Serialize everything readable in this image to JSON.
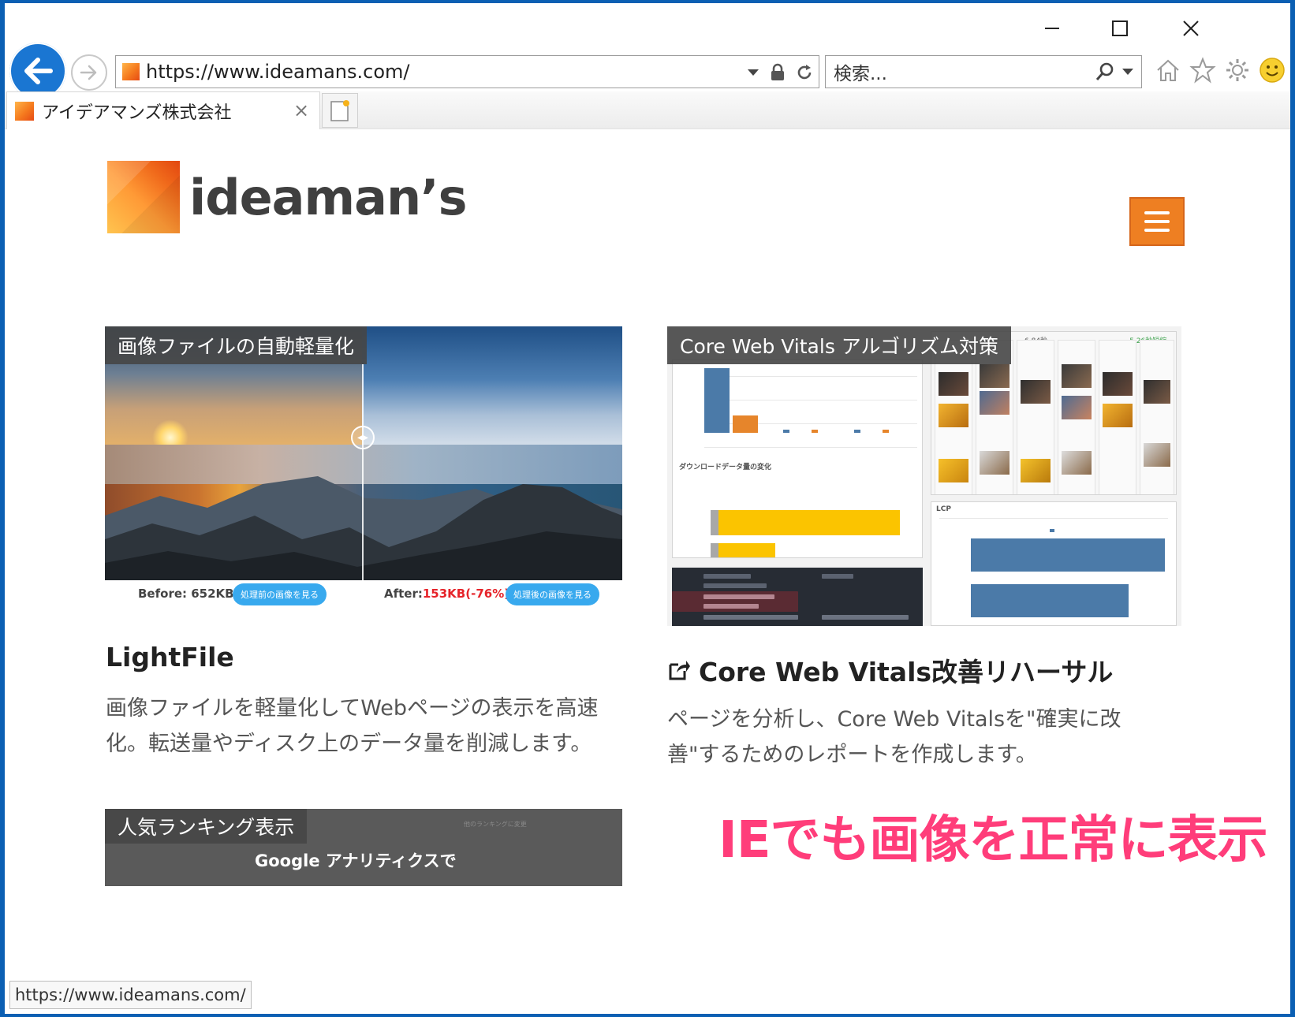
{
  "window": {
    "minimize_label": "minimize",
    "maximize_label": "maximize",
    "close_label": "close"
  },
  "browser": {
    "address": "https://www.ideamans.com/",
    "search_placeholder": "検索...",
    "tab_title": "アイデアマンズ株式会社",
    "status_url": "https://www.ideamans.com/"
  },
  "site": {
    "logo_text": "ideaman’s",
    "accent": "#ee7f22"
  },
  "cards": [
    {
      "label": "画像ファイルの自動軽量化",
      "title": "LightFile",
      "desc": "画像ファイルを軽量化してWebページの表示を高速化。転送量やディスク上のデータ量を削減します。",
      "image": {
        "before_text": "Before: 652KB",
        "after_prefix": "After:",
        "after_value": "153KB(-76%)",
        "before_button": "処理前の画像を見る",
        "after_button": "処理後の画像を見る"
      }
    },
    {
      "label": "Core Web Vitals アルゴリズム対策",
      "title": "Core Web Vitals改善リハーサル",
      "desc": "ページを分析し、Core Web Vitalsを\"確実に改善\"するためのレポートを作成します。",
      "image": {
        "chart_caption": "ダウンロードデータ量の変化",
        "lcp_title": "LCP",
        "badge_left": "6.84秒",
        "badge_right": "-5.26秒短縮"
      }
    }
  ],
  "bottom_card": {
    "label": "人気ランキング表示",
    "subtitle": "Google アナリティクスで",
    "faint": "他のランキングに変更"
  },
  "annotation": {
    "text": "IEでも画像を正常に表示",
    "color": "#ff3d7a"
  },
  "icons": {
    "back": "back-arrow-icon",
    "forward": "forward-arrow-icon",
    "lock": "lock-icon",
    "refresh": "refresh-icon",
    "search": "search-icon",
    "home": "home-icon",
    "favorites": "star-icon",
    "settings": "gear-icon",
    "feedback": "smiley-icon",
    "menu": "hamburger-icon",
    "external": "external-link-icon"
  }
}
